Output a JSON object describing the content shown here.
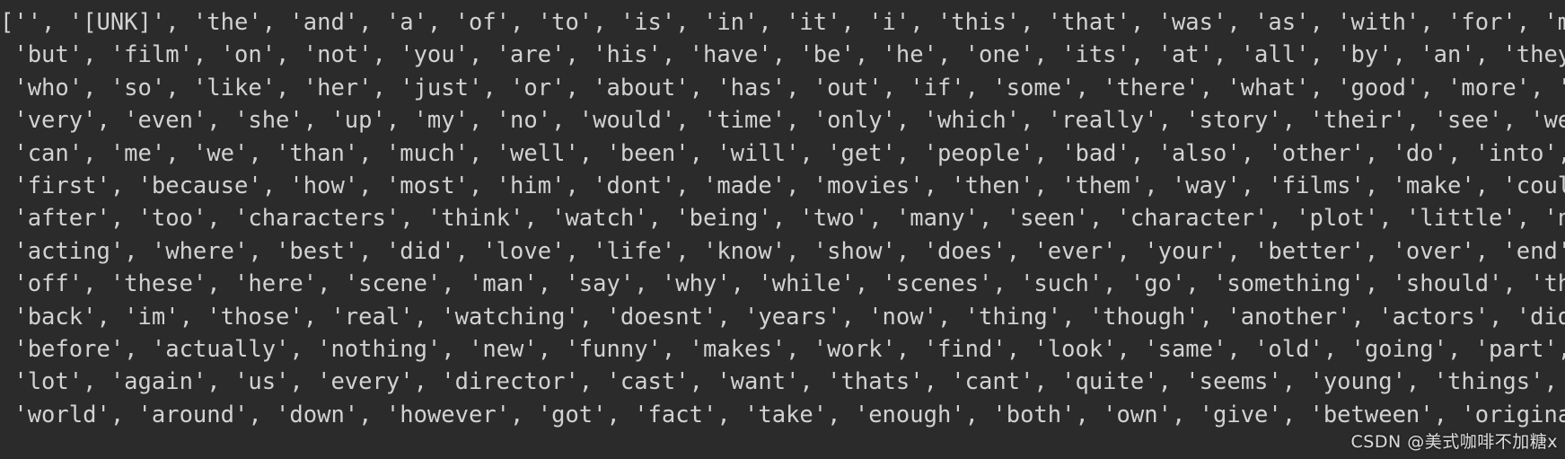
{
  "console": {
    "background_color": "#2b2b2b",
    "text_color": "#d2d2d2",
    "output_lines": [
      "['', '[UNK]', 'the', 'and', 'a', 'of', 'to', 'is', 'in', 'it', 'i', 'this', 'that', 'was', 'as', 'with', 'for', 'movie',",
      " 'but', 'film', 'on', 'not', 'you', 'are', 'his', 'have', 'be', 'he', 'one', 'its', 'at', 'all', 'by', 'an', 'they', 'from',",
      " 'who', 'so', 'like', 'her', 'just', 'or', 'about', 'has', 'out', 'if', 'some', 'there', 'what', 'good', 'more', 'when',",
      " 'very', 'even', 'she', 'up', 'my', 'no', 'would', 'time', 'only', 'which', 'really', 'story', 'their', 'see', 'were', 'had',",
      " 'can', 'me', 'we', 'than', 'much', 'well', 'been', 'will', 'get', 'people', 'bad', 'also', 'other', 'do', 'into', 'great',",
      " 'first', 'because', 'how', 'most', 'him', 'dont', 'made', 'movies', 'then', 'them', 'way', 'films', 'make', 'could', 'any',",
      " 'after', 'too', 'characters', 'think', 'watch', 'being', 'two', 'many', 'seen', 'character', 'plot', 'little', 'never',",
      " 'acting', 'where', 'best', 'did', 'love', 'life', 'know', 'show', 'does', 'ever', 'your', 'better', 'over', 'end', 'still',",
      " 'off', 'these', 'here', 'scene', 'man', 'say', 'why', 'while', 'scenes', 'such', 'go', 'something', 'should', 'through',",
      " 'back', 'im', 'those', 'real', 'watching', 'doesnt', 'years', 'now', 'thing', 'though', 'another', 'actors', 'didnt',",
      " 'before', 'actually', 'nothing', 'new', 'funny', 'makes', 'work', 'find', 'look', 'same', 'old', 'going', 'part', 'few',",
      " 'lot', 'again', 'us', 'every', 'director', 'cast', 'want', 'thats', 'cant', 'quite', 'seems', 'young', 'things', 'pretty',",
      " 'world', 'around', 'down', 'however', 'got', 'fact', 'take', 'enough', 'both', 'own', 'give', 'between', 'original'"
    ]
  },
  "watermark": {
    "text": "CSDN @美式咖啡不加糖x"
  }
}
